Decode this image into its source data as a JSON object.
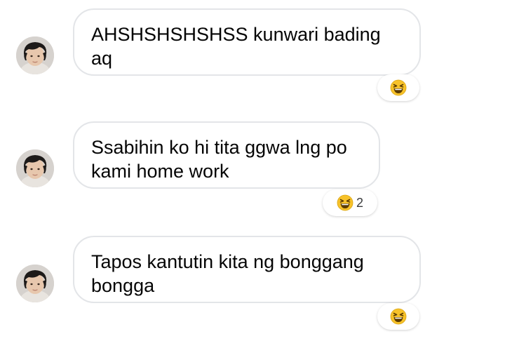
{
  "messages": [
    {
      "lines": [
        "AHSHSHSHSHSS kunwari bading",
        "aq"
      ],
      "reaction": {
        "emoji": "laughing-squinting-face",
        "count": ""
      }
    },
    {
      "lines": [
        "Ssabihin ko hi tita ggwa lng po",
        "kami home work"
      ],
      "reaction": {
        "emoji": "laughing-squinting-face",
        "count": "2"
      }
    },
    {
      "lines": [
        "Tapos kantutin kita ng bonggang",
        "bongga"
      ],
      "reaction": {
        "emoji": "laughing-squinting-face",
        "count": ""
      }
    }
  ],
  "colors": {
    "bubble_border": "#e3e5e8",
    "text": "#050505",
    "emoji_yellow": "#f7c22a"
  }
}
